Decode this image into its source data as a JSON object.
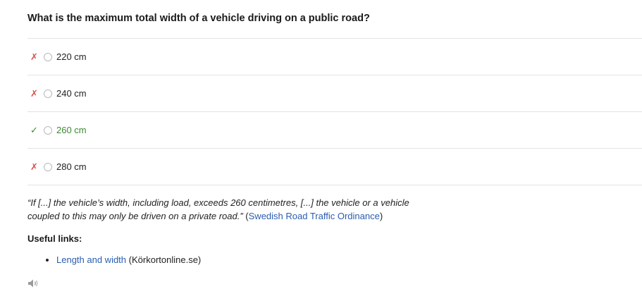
{
  "question": "What is the maximum total width of a vehicle driving on a public road?",
  "options": [
    {
      "label": "220 cm",
      "status": "wrong",
      "mark": "✗"
    },
    {
      "label": "240 cm",
      "status": "wrong",
      "mark": "✗"
    },
    {
      "label": "260 cm",
      "status": "correct",
      "mark": "✓"
    },
    {
      "label": "280 cm",
      "status": "wrong",
      "mark": "✗"
    }
  ],
  "explanation": {
    "quote": "“If [...] the vehicle’s width, including load, exceeds 260 centimetres, [...] the vehicle or a vehicle coupled to this may only be driven on a private road.”",
    "source_link": "Swedish Road Traffic Ordinance",
    "source_open": "(",
    "source_close": ")"
  },
  "useful_links": {
    "heading": "Useful links:",
    "items": [
      {
        "link_text": "Length and width",
        "suffix": "(Körkortonline.se)"
      }
    ]
  },
  "colors": {
    "wrong": "#d9534f",
    "correct": "#3c8a2e",
    "link": "#2a5db0"
  },
  "icons": {
    "audio": "speaker-icon"
  }
}
